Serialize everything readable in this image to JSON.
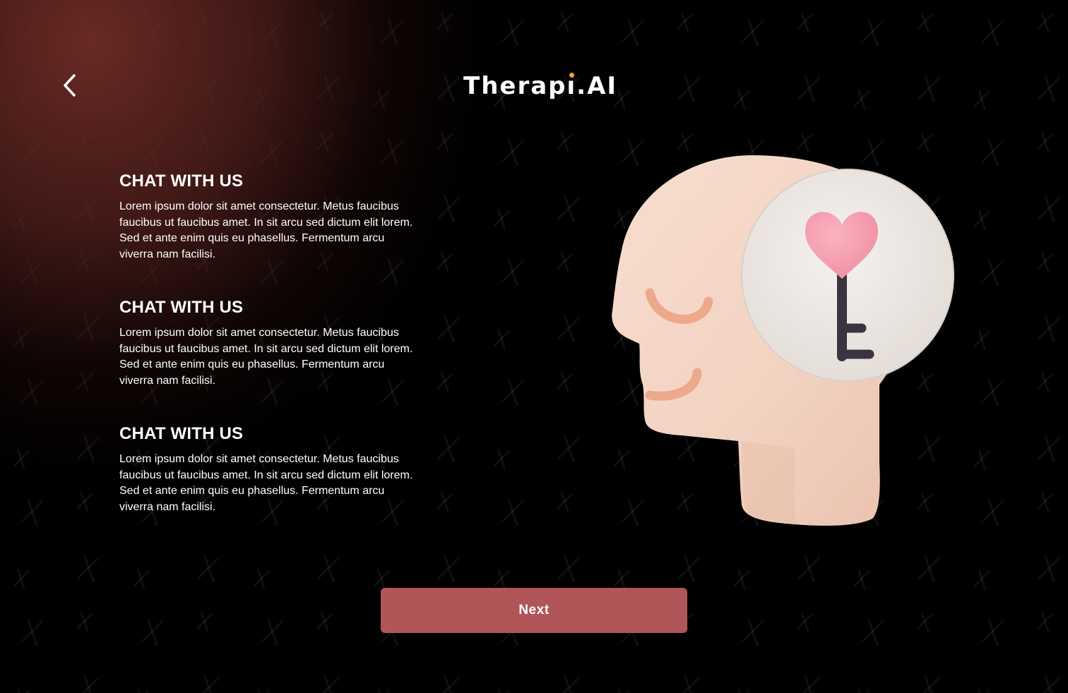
{
  "header": {
    "back_icon": "chevron-left-icon",
    "logo": {
      "prefix": "Therap",
      "i_letter": "ı",
      "suffix": ".AI",
      "accent_color": "#f2a03c"
    }
  },
  "sections": [
    {
      "title": "CHAT WITH US",
      "body": "Lorem ipsum dolor sit amet consectetur. Metus faucibus faucibus ut faucibus amet. In sit arcu sed dictum elit lorem. Sed et ante enim quis eu phasellus. Fermentum arcu viverra nam facilisi."
    },
    {
      "title": "CHAT WITH US",
      "body": "Lorem ipsum dolor sit amet consectetur. Metus faucibus faucibus ut faucibus amet. In sit arcu sed dictum elit lorem. Sed et ante enim quis eu phasellus. Fermentum arcu viverra nam facilisi."
    },
    {
      "title": "CHAT WITH US",
      "body": "Lorem ipsum dolor sit amet consectetur. Metus faucibus faucibus ut faucibus amet. In sit arcu sed dictum elit lorem. Sed et ante enim quis eu phasellus. Fermentum arcu viverra nam facilisi."
    }
  ],
  "illustration": {
    "icon": "head-heart-key-illustration"
  },
  "footer": {
    "next_label": "Next",
    "button_color": "#b05558"
  },
  "theme": {
    "background": "#000000",
    "glow": "#6e2c26"
  }
}
